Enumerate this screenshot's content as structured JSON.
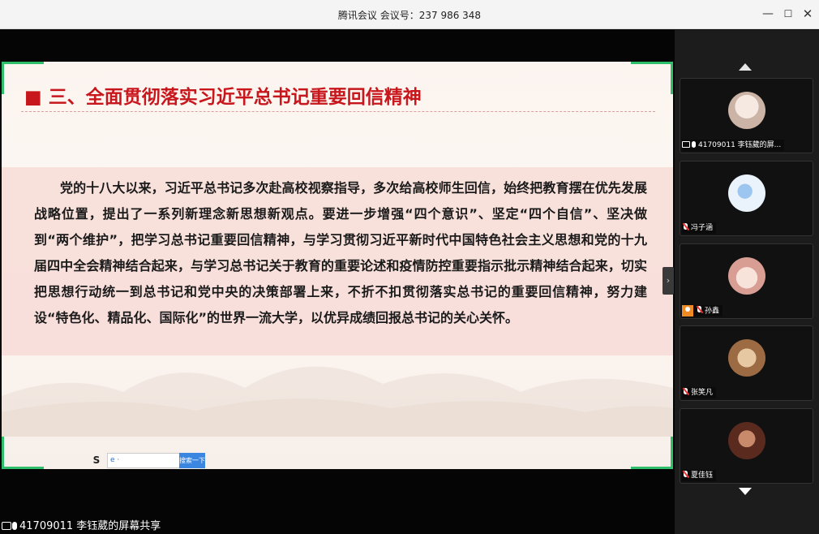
{
  "window": {
    "title": "腾讯会议 会议号：237 986 348",
    "minimize": "—",
    "maximize": "☐",
    "close": "✕"
  },
  "slide": {
    "title": "■ 三、全面贯彻落实习近平总书记重要回信精神",
    "paragraph": "党的十八大以来，习近平总书记多次赴高校视察指导，多次给高校师生回信，始终把教育摆在优先发展战略位置，提出了一系列新理念新思想新观点。要进一步增强“四个意识”、坚定“四个自信”、坚决做到“两个维护”，把学习总书记重要回信精神，与学习贯彻习近平新时代中国特色社会主义思想和党的十九届四中全会精神结合起来，与学习总书记关于教育的重要论述和疫情防控重要指示批示精神结合起来，切实把思想行动统一到总书记和党中央的决策部署上来，不折不扣贯彻落实总书记的重要回信精神，努力建设“特色化、精品化、国际化”的世界一流大学，以优异成绩回报总书记的关心关怀。",
    "mini_app": {
      "logo": "S",
      "field_text": "e ·",
      "button": "搜索一下"
    }
  },
  "share_bar": {
    "label": "41709011 李钰葳的屏幕共享"
  },
  "collapse_glyph": "›",
  "participants": [
    {
      "name": "41709011 李钰葳的屏...",
      "avatar_color": "#d8c9c0"
    },
    {
      "name": "冯子涵",
      "avatar_color": "#d7e8f6"
    },
    {
      "name": "孙鑫",
      "avatar_color": "#f3d8d0",
      "host": true
    },
    {
      "name": "张笑凡",
      "avatar_color": "#b88a5e"
    },
    {
      "name": "夏佳钰",
      "avatar_color": "#7a3b2e"
    }
  ],
  "colors": {
    "accent_red": "#c8161d",
    "corner_green": "#2fbf6a",
    "host_orange": "#f08a24"
  }
}
